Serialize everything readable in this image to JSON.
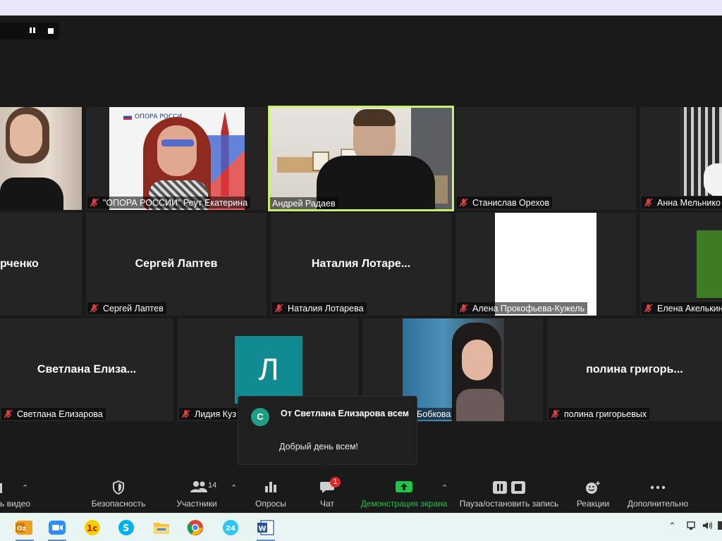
{
  "recording_controls": {
    "pause_icon": "pause-icon",
    "stop_icon": "stop-icon"
  },
  "tiles": [
    {
      "label": ""
    },
    {
      "label": "\"ОПОРА РОССИИ\" Реут Екатерина"
    },
    {
      "label": "Андрей Радаев"
    },
    {
      "label": "Станислав Орехов"
    },
    {
      "label": "Анна Мельнико"
    },
    {
      "big": "рченко",
      "label": ""
    },
    {
      "big": "Сергей Лаптев",
      "label": "Сергей Лаптев"
    },
    {
      "big": "Наталия  Лотаре...",
      "label": "Наталия Лотарева"
    },
    {
      "label": "Алена Прокофьева-Кужель"
    },
    {
      "label": "Елена Акелькин"
    },
    {
      "big": "Светлана  Елиза...",
      "label": "Светлана Елизарова"
    },
    {
      "avatar_letter": "Л",
      "label": "Лидия Куз"
    },
    {
      "label": "Бобкова"
    },
    {
      "big": "полина  григорь...",
      "label": "полина григорьевых"
    }
  ],
  "opora_logo_text": "ОПОРА РОССИ",
  "chat_notification": {
    "avatar_letter": "С",
    "from": "От Светлана Елизарова всем",
    "message": "Добрый день всем!"
  },
  "toolbar": {
    "video_label": "ь видео",
    "security_label": "Безопасность",
    "participants_label": "Участники",
    "participants_count": "14",
    "polls_label": "Опросы",
    "chat_label": "Чат",
    "chat_badge": "1",
    "share_label": "Демонстрация экрана",
    "record_label": "Пауза/остановить запись",
    "reactions_label": "Реакции",
    "more_label": "Дополнительно"
  },
  "colors": {
    "accent_green": "#1fc34a",
    "active_border": "#c9f06c",
    "badge_red": "#e02828",
    "avatar_teal": "#128a92"
  }
}
